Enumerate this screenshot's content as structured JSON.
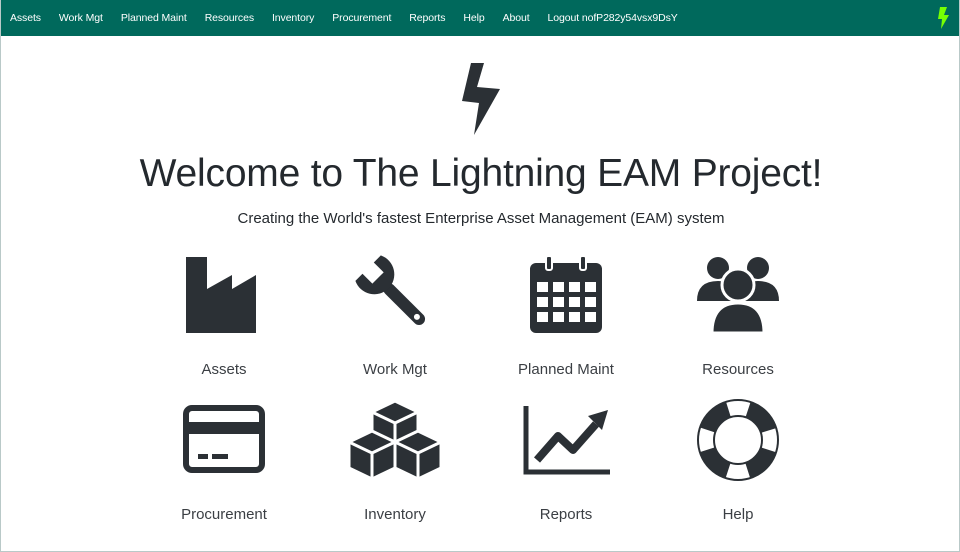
{
  "nav": {
    "items": [
      {
        "label": "Assets"
      },
      {
        "label": "Work Mgt"
      },
      {
        "label": "Planned Maint"
      },
      {
        "label": "Resources"
      },
      {
        "label": "Inventory"
      },
      {
        "label": "Procurement"
      },
      {
        "label": "Reports"
      },
      {
        "label": "Help"
      },
      {
        "label": "About"
      },
      {
        "label": "Logout nofP282y54vsx9DsY"
      }
    ],
    "brand_icon": "lightning-bolt-icon"
  },
  "main": {
    "title": "Welcome to The Lightning EAM Project!",
    "subtitle": "Creating the World's fastest Enterprise Asset Management (EAM) system",
    "tiles": [
      {
        "label": "Assets",
        "icon": "factory-icon"
      },
      {
        "label": "Work Mgt",
        "icon": "wrench-icon"
      },
      {
        "label": "Planned Maint",
        "icon": "calendar-icon"
      },
      {
        "label": "Resources",
        "icon": "users-icon"
      },
      {
        "label": "Procurement",
        "icon": "credit-card-icon"
      },
      {
        "label": "Inventory",
        "icon": "cubes-icon"
      },
      {
        "label": "Reports",
        "icon": "line-chart-icon"
      },
      {
        "label": "Help",
        "icon": "life-ring-icon"
      }
    ]
  },
  "colors": {
    "navbar": "#00695c",
    "brand_bolt": "#76ff03",
    "icon": "#2b3035",
    "text": "#24292e"
  }
}
